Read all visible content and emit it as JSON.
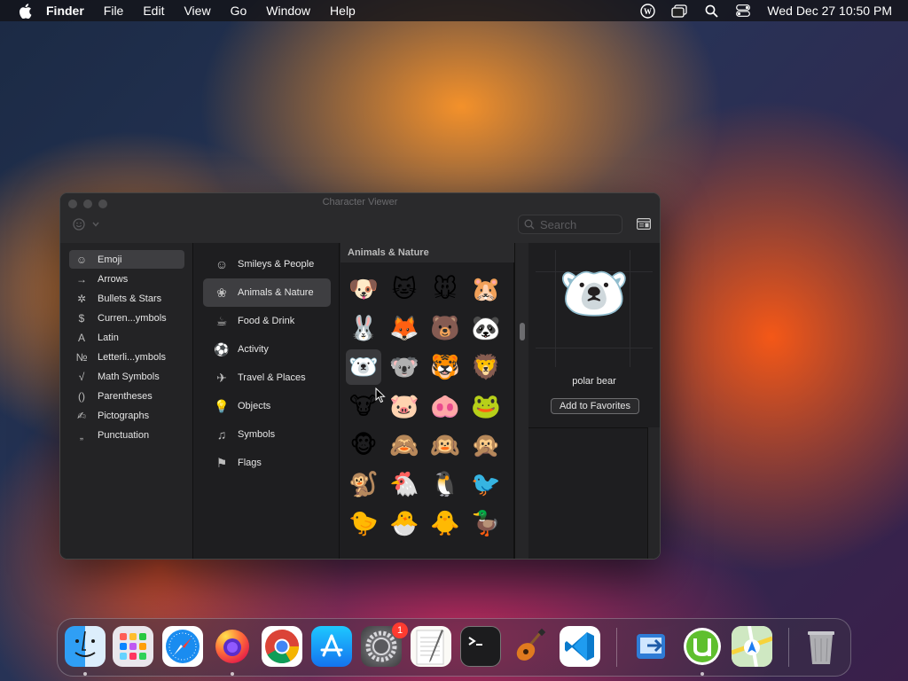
{
  "menubar": {
    "app_name": "Finder",
    "menus": [
      "File",
      "Edit",
      "View",
      "Go",
      "Window",
      "Help"
    ],
    "clock": "Wed Dec 27  10:50 PM",
    "status_icons": [
      "wordpress-icon",
      "screens-icon",
      "spotlight-search-icon",
      "control-center-icon"
    ]
  },
  "window": {
    "title": "Character Viewer",
    "search_placeholder": "Search",
    "categories": [
      {
        "label": "Emoji",
        "icon": "☺",
        "selected": true
      },
      {
        "label": "Arrows",
        "icon": "→"
      },
      {
        "label": "Bullets & Stars",
        "icon": "✲"
      },
      {
        "label": "Curren...ymbols",
        "icon": "$"
      },
      {
        "label": "Latin",
        "icon": "A"
      },
      {
        "label": "Letterli...ymbols",
        "icon": "№"
      },
      {
        "label": "Math Symbols",
        "icon": "√"
      },
      {
        "label": "Parentheses",
        "icon": "()"
      },
      {
        "label": "Pictographs",
        "icon": "✍"
      },
      {
        "label": "Punctuation",
        "icon": "„"
      }
    ],
    "subcategories": [
      {
        "label": "Smileys & People",
        "icon": "☺"
      },
      {
        "label": "Animals & Nature",
        "icon": "❀",
        "selected": true
      },
      {
        "label": "Food & Drink",
        "icon": "☕"
      },
      {
        "label": "Activity",
        "icon": "⚽"
      },
      {
        "label": "Travel & Places",
        "icon": "✈"
      },
      {
        "label": "Objects",
        "icon": "💡"
      },
      {
        "label": "Symbols",
        "icon": "♫"
      },
      {
        "label": "Flags",
        "icon": "⚑"
      }
    ],
    "section_title": "Animals & Nature",
    "emojis": [
      "🐶",
      "🐱",
      "🐭",
      "🐹",
      "🐰",
      "🦊",
      "🐻",
      "🐼",
      "🐻‍❄️",
      "🐨",
      "🐯",
      "🦁",
      "🐮",
      "🐷",
      "🐽",
      "🐸",
      "🐵",
      "🙈",
      "🙉",
      "🙊",
      "🐒",
      "🐔",
      "🐧",
      "🐦",
      "🐤",
      "🐣",
      "🐥",
      "🦆"
    ],
    "selected_emoji_index": 8,
    "preview": {
      "emoji": "🐻‍❄️",
      "name": "polar bear",
      "add_favorites_label": "Add to Favorites"
    }
  },
  "dock": {
    "apps": [
      "Finder",
      "Launchpad",
      "Safari",
      "Firefox",
      "Chrome",
      "App Store",
      "System Settings",
      "TextEdit",
      "Terminal",
      "GarageBand",
      "Visual Studio Code",
      "Migration Assistant",
      "uTorrent",
      "Maps",
      "Trash"
    ],
    "settings_badge": "1"
  }
}
